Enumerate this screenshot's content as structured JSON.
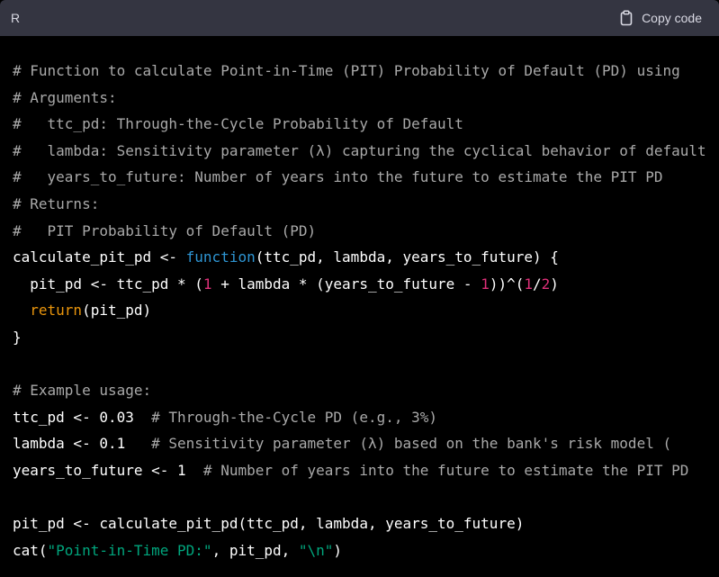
{
  "header": {
    "language": "R",
    "copy_label": "Copy code",
    "copy_icon": "clipboard-icon"
  },
  "code": {
    "lines": [
      [
        {
          "t": "# Function to calculate Point-in-Time (PIT) Probability of Default (PD) using",
          "c": "c"
        }
      ],
      [
        {
          "t": "# Arguments:",
          "c": "c"
        }
      ],
      [
        {
          "t": "#   ttc_pd: Through-the-Cycle Probability of Default",
          "c": "c"
        }
      ],
      [
        {
          "t": "#   lambda: Sensitivity parameter (λ) capturing the cyclical behavior of default",
          "c": "c"
        }
      ],
      [
        {
          "t": "#   years_to_future: Number of years into the future to estimate the PIT PD",
          "c": "c"
        }
      ],
      [
        {
          "t": "# Returns:",
          "c": "c"
        }
      ],
      [
        {
          "t": "#   PIT Probability of Default (PD)",
          "c": "c"
        }
      ],
      [
        {
          "t": "calculate_pit_pd <- ",
          "c": ""
        },
        {
          "t": "function",
          "c": "k"
        },
        {
          "t": "(ttc_pd, lambda, years_to_future) {",
          "c": ""
        }
      ],
      [
        {
          "t": "  pit_pd <- ttc_pd * (",
          "c": ""
        },
        {
          "t": "1",
          "c": "r"
        },
        {
          "t": " + lambda * (years_to_future - ",
          "c": ""
        },
        {
          "t": "1",
          "c": "r"
        },
        {
          "t": "))^(",
          "c": ""
        },
        {
          "t": "1",
          "c": "r"
        },
        {
          "t": "/",
          "c": ""
        },
        {
          "t": "2",
          "c": "r"
        },
        {
          "t": ")",
          "c": ""
        }
      ],
      [
        {
          "t": "  ",
          "c": ""
        },
        {
          "t": "return",
          "c": "b"
        },
        {
          "t": "(pit_pd)",
          "c": ""
        }
      ],
      [
        {
          "t": "}",
          "c": ""
        }
      ],
      [],
      [
        {
          "t": "# Example usage:",
          "c": "c"
        }
      ],
      [
        {
          "t": "ttc_pd <- 0.03  ",
          "c": ""
        },
        {
          "t": "# Through-the-Cycle PD (e.g., 3%)",
          "c": "c"
        }
      ],
      [
        {
          "t": "lambda <- 0.1   ",
          "c": ""
        },
        {
          "t": "# Sensitivity parameter (λ) based on the bank's risk model (",
          "c": "c"
        }
      ],
      [
        {
          "t": "years_to_future <- 1  ",
          "c": ""
        },
        {
          "t": "# Number of years into the future to estimate the PIT PD",
          "c": "c"
        }
      ],
      [],
      [
        {
          "t": "pit_pd <- calculate_pit_pd(ttc_pd, lambda, years_to_future)",
          "c": ""
        }
      ],
      [
        {
          "t": "cat(",
          "c": ""
        },
        {
          "t": "\"Point-in-Time PD:\"",
          "c": "s"
        },
        {
          "t": ", pit_pd, ",
          "c": ""
        },
        {
          "t": "\"\\n\"",
          "c": "s"
        },
        {
          "t": ")",
          "c": ""
        }
      ]
    ]
  },
  "colors": {
    "background": "#000000",
    "header_bg": "#343541",
    "comment": "#a9a9a9",
    "keyword": "#2e95d3",
    "number": "#df3079",
    "builtin": "#e9950c",
    "string": "#00a67d"
  }
}
